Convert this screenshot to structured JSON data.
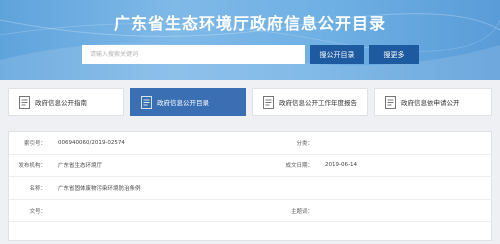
{
  "header": {
    "title": "广东省生态环境厅政府信息公开目录",
    "search": {
      "placeholder": "请输入搜索关键词",
      "search_button": "搜公开目录",
      "more_button": "搜更多"
    }
  },
  "tabs": [
    {
      "label": "政府信息公开指南",
      "icon": "document-icon",
      "active": false
    },
    {
      "label": "政府信息公开目录",
      "icon": "document-icon",
      "active": true
    },
    {
      "label": "政府信息公开工作年度报告",
      "icon": "document-icon",
      "active": false
    },
    {
      "label": "政府信息依申请公开",
      "icon": "document-icon",
      "active": false
    }
  ],
  "info": {
    "index_label": "索引号：",
    "index_value": "006940060/2019-02574",
    "category_label": "分类：",
    "category_value": "",
    "publisher_label": "发布机构：",
    "publisher_value": "广东省生态环境厅",
    "date_label": "成文日期：",
    "date_value": "2019-06-14",
    "name_label": "名称：",
    "name_value": "广东省固体废物污染环境防治条例",
    "doc_no_label": "文号：",
    "doc_no_value": "",
    "subject_label": "主题词：",
    "subject_value": ""
  },
  "colors": {
    "banner": "#6fb0e4",
    "button": "#1e5a9f",
    "active_tab": "#3a6fb3",
    "background": "#eef0f3"
  }
}
